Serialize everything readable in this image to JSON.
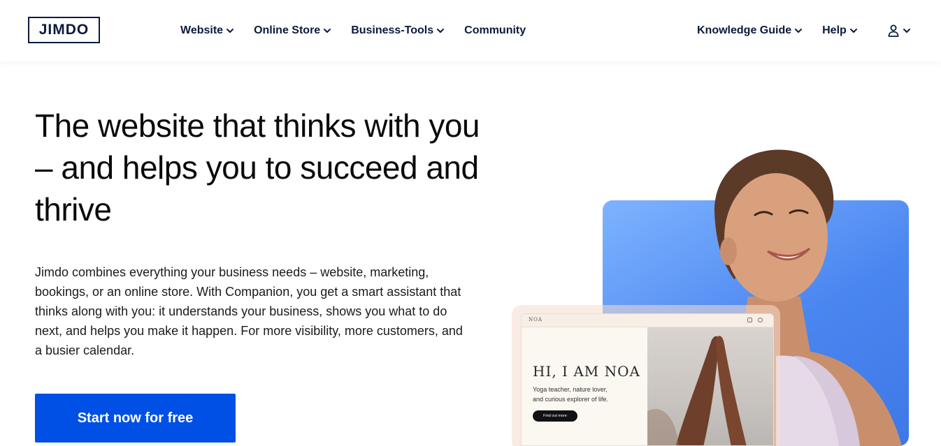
{
  "brand": {
    "logo_text": "JIMDO"
  },
  "nav": {
    "left": [
      {
        "label": "Website",
        "icon": "chevron-down-icon"
      },
      {
        "label": "Online Store",
        "icon": "chevron-down-icon"
      },
      {
        "label": "Business-Tools",
        "icon": "chevron-down-icon"
      },
      {
        "label": "Community"
      }
    ],
    "right": [
      {
        "label": "Knowledge Guide",
        "icon": "chevron-down-icon"
      },
      {
        "label": "Help",
        "icon": "chevron-down-icon"
      }
    ],
    "account_icon": "user-icon"
  },
  "hero": {
    "headline": "The website that thinks with you – and helps you to succeed and thrive",
    "description": "Jimdo combines everything your business needs – website, marketing, bookings, or an online store. With Companion, you get a smart assistant that thinks along with you: it understands your business, shows you what to do next, and helps you make it happen. For more visibility, more customers, and a busier calendar.",
    "cta_label": "Start now for free"
  },
  "mockup": {
    "brand": "NOA",
    "title": "HI, I AM NOA",
    "subtitle_line1": "Yoga teacher, nature lover,",
    "subtitle_line2": "and curious explorer of life.",
    "button_label": "Find out more"
  },
  "colors": {
    "brand_navy": "#0c1a3d",
    "cta_blue": "#0050e6",
    "card_blue": "#4a86f0"
  }
}
